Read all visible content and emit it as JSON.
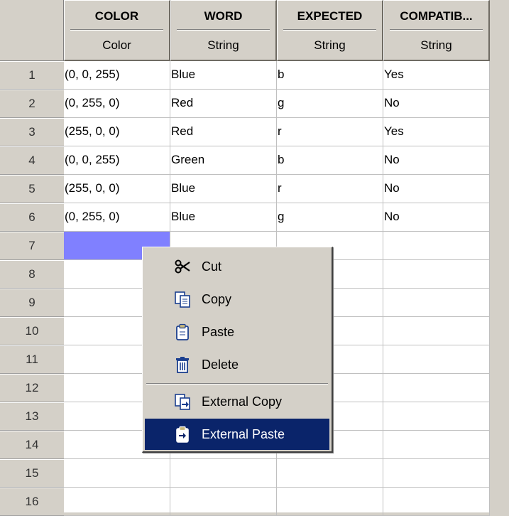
{
  "columns": [
    {
      "name": "COLOR",
      "type": "Color"
    },
    {
      "name": "WORD",
      "type": "String"
    },
    {
      "name": "EXPECTED",
      "type": "String"
    },
    {
      "name": "COMPATIB...",
      "type": "String"
    }
  ],
  "row_numbers": [
    "1",
    "2",
    "3",
    "4",
    "5",
    "6",
    "7",
    "8",
    "9",
    "10",
    "11",
    "12",
    "13",
    "14",
    "15",
    "16"
  ],
  "rows": [
    [
      "(0, 0, 255)",
      "Blue",
      "b",
      "Yes"
    ],
    [
      "(0, 255, 0)",
      "Red",
      "g",
      "No"
    ],
    [
      "(255, 0, 0)",
      "Red",
      "r",
      "Yes"
    ],
    [
      "(0, 0, 255)",
      "Green",
      "b",
      "No"
    ],
    [
      "(255, 0, 0)",
      "Blue",
      "r",
      "No"
    ],
    [
      "(0, 255, 0)",
      "Blue",
      "g",
      "No"
    ]
  ],
  "context_menu": {
    "cut": "Cut",
    "copy": "Copy",
    "paste": "Paste",
    "delete": "Delete",
    "external_copy": "External Copy",
    "external_paste": "External Paste"
  },
  "colors": {
    "selection": "#8080ff",
    "menu_highlight": "#0a246a"
  }
}
